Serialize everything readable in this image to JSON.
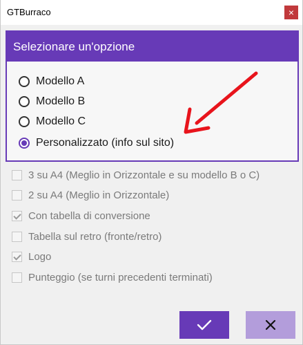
{
  "window": {
    "title": "GTBurraco",
    "close_glyph": "×",
    "close_icon": "close-icon"
  },
  "group": {
    "header": "Selezionare un'opzione",
    "options": [
      {
        "label": "Modello A",
        "checked": false
      },
      {
        "label": "Modello B",
        "checked": false
      },
      {
        "label": "Modello C",
        "checked": false
      },
      {
        "label": "Personalizzato (info sul sito)",
        "checked": true
      }
    ]
  },
  "checkboxes": [
    {
      "label": "3 su A4 (Meglio in Orizzontale e su modello B o C)",
      "checked": false
    },
    {
      "label": "2 su A4 (Meglio in Orizzontale)",
      "checked": false
    },
    {
      "label": "Con tabella di conversione",
      "checked": true
    },
    {
      "label": "Tabella sul retro (fronte/retro)",
      "checked": false
    },
    {
      "label": "Logo",
      "checked": true
    },
    {
      "label": "Punteggio (se turni precedenti terminati)",
      "checked": false
    }
  ],
  "buttons": {
    "ok_icon": "checkmark-icon",
    "cancel_icon": "x-icon"
  },
  "colors": {
    "accent": "#673ab7",
    "accent_light": "#b39ddb",
    "annotation_arrow": "#e8141c",
    "close_button": "#c1393c"
  }
}
